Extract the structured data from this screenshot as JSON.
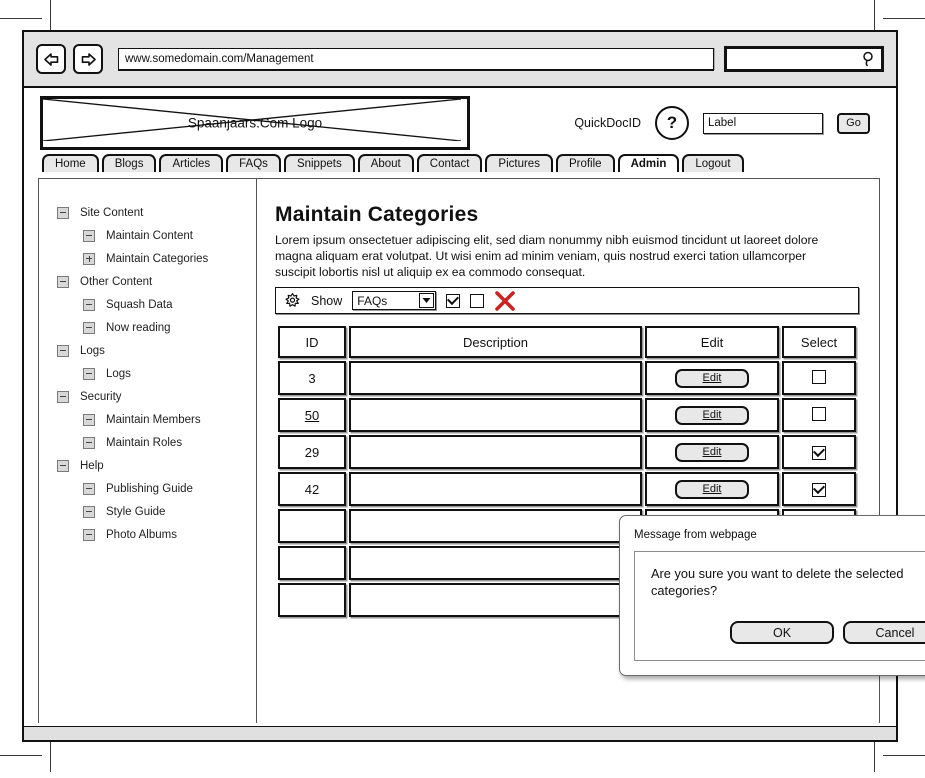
{
  "browser": {
    "back_icon": "back-arrow-icon",
    "forward_icon": "forward-arrow-icon",
    "url": "www.somedomain.com/Management",
    "search_value": "",
    "search_icon": "magnifier-icon"
  },
  "site_header": {
    "logo_text": "Spaanjaars.Com Logo",
    "quickdoc_label": "QuickDocID",
    "help_icon": "question-mark-icon",
    "label_input_value": "Label",
    "go_label": "Go"
  },
  "tabs": [
    {
      "label": "Home",
      "active": false
    },
    {
      "label": "Blogs",
      "active": false
    },
    {
      "label": "Articles",
      "active": false
    },
    {
      "label": "FAQs",
      "active": false
    },
    {
      "label": "Snippets",
      "active": false
    },
    {
      "label": "About",
      "active": false
    },
    {
      "label": "Contact",
      "active": false
    },
    {
      "label": "Pictures",
      "active": false
    },
    {
      "label": "Profile",
      "active": false
    },
    {
      "label": "Admin",
      "active": true
    },
    {
      "label": "Logout",
      "active": false
    }
  ],
  "sidebar": {
    "items": [
      {
        "label": "Site Content",
        "level": 0,
        "toggle": "minus"
      },
      {
        "label": "Maintain Content",
        "level": 1,
        "toggle": "minus"
      },
      {
        "label": "Maintain Categories",
        "level": 1,
        "toggle": "plus"
      },
      {
        "label": "Other Content",
        "level": 0,
        "toggle": "minus"
      },
      {
        "label": "Squash Data",
        "level": 1,
        "toggle": "minus"
      },
      {
        "label": "Now reading",
        "level": 1,
        "toggle": "minus"
      },
      {
        "label": "Logs",
        "level": 0,
        "toggle": "minus"
      },
      {
        "label": "Logs",
        "level": 1,
        "toggle": "minus"
      },
      {
        "label": "Security",
        "level": 0,
        "toggle": "minus"
      },
      {
        "label": "Maintain Members",
        "level": 1,
        "toggle": "minus"
      },
      {
        "label": "Maintain Roles",
        "level": 1,
        "toggle": "minus"
      },
      {
        "label": "Help",
        "level": 0,
        "toggle": "minus"
      },
      {
        "label": "Publishing Guide",
        "level": 1,
        "toggle": "minus"
      },
      {
        "label": "Style Guide",
        "level": 1,
        "toggle": "minus"
      },
      {
        "label": "Photo Albums",
        "level": 1,
        "toggle": "minus"
      }
    ]
  },
  "main": {
    "title": "Maintain Categories",
    "description": "Lorem ipsum onsectetuer adipiscing elit, sed diam nonummy nibh euismod tincidunt ut laoreet dolore magna aliquam erat volutpat. Ut wisi enim ad minim veniam, quis nostrud exerci tation ullamcorper suscipit lobortis nisl ut aliquip ex ea commodo consequat.",
    "toolbar": {
      "gear_icon": "gear-icon",
      "show_label": "Show",
      "filter_selected": "FAQs",
      "filter_options": [
        "FAQs"
      ],
      "dropdown_icon": "chevron-down-icon",
      "checkbox_1_checked": true,
      "checkbox_2_checked": false,
      "delete_icon": "red-x-delete-icon",
      "delete_icon_color": "#cc2222"
    },
    "table": {
      "columns": [
        "ID",
        "Description",
        "Edit",
        "Select"
      ],
      "edit_label": "Edit",
      "rows": [
        {
          "id": "3",
          "id_is_link": false,
          "description": "",
          "has_edit": true,
          "selected": false
        },
        {
          "id": "50",
          "id_is_link": true,
          "description": "",
          "has_edit": true,
          "selected": false
        },
        {
          "id": "29",
          "id_is_link": false,
          "description": "",
          "has_edit": true,
          "selected": true
        },
        {
          "id": "42",
          "id_is_link": false,
          "description": "",
          "has_edit": true,
          "selected": true
        },
        {
          "id": "",
          "id_is_link": false,
          "description": "",
          "has_edit": true,
          "selected": true
        },
        {
          "id": "",
          "id_is_link": false,
          "description": "",
          "has_edit": true,
          "selected": true
        },
        {
          "id": "",
          "id_is_link": false,
          "description": "",
          "has_edit": true,
          "selected": true
        }
      ]
    }
  },
  "modal": {
    "title": "Message from webpage",
    "message": "Are you sure you want to delete the selected categories?",
    "ok_label": "OK",
    "cancel_label": "Cancel"
  }
}
